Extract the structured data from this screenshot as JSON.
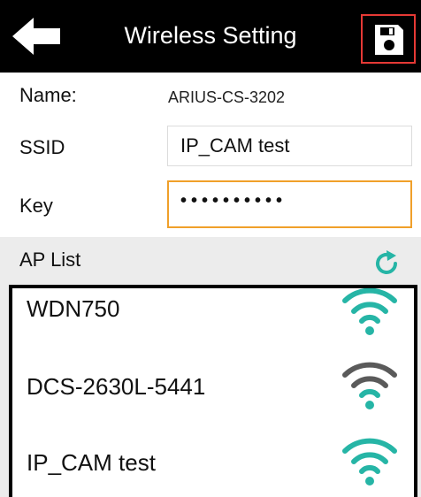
{
  "header": {
    "title": "Wireless Setting",
    "back_icon": "arrow-left-icon",
    "save_icon": "floppy-disk-icon",
    "save_highlight_color": "#e53935"
  },
  "form": {
    "name_label": "Name:",
    "name_value": "ARIUS-CS-3202",
    "ssid_label": "SSID",
    "ssid_value": "IP_CAM test",
    "key_label": "Key",
    "key_value": "••••••••••",
    "key_focus_color": "#f0a02a"
  },
  "ap_list": {
    "label": "AP List",
    "refresh_icon": "refresh-icon",
    "accent_color": "#26b5a6",
    "items": [
      {
        "name": "WDN750",
        "signal_icon": "wifi-icon",
        "signal_color": "#26b5a6"
      },
      {
        "name": "DCS-2630L-5441",
        "signal_icon": "wifi-icon",
        "signal_color": "#5a5a5a"
      },
      {
        "name": "IP_CAM test",
        "signal_icon": "wifi-icon",
        "signal_color": "#26b5a6"
      }
    ]
  }
}
